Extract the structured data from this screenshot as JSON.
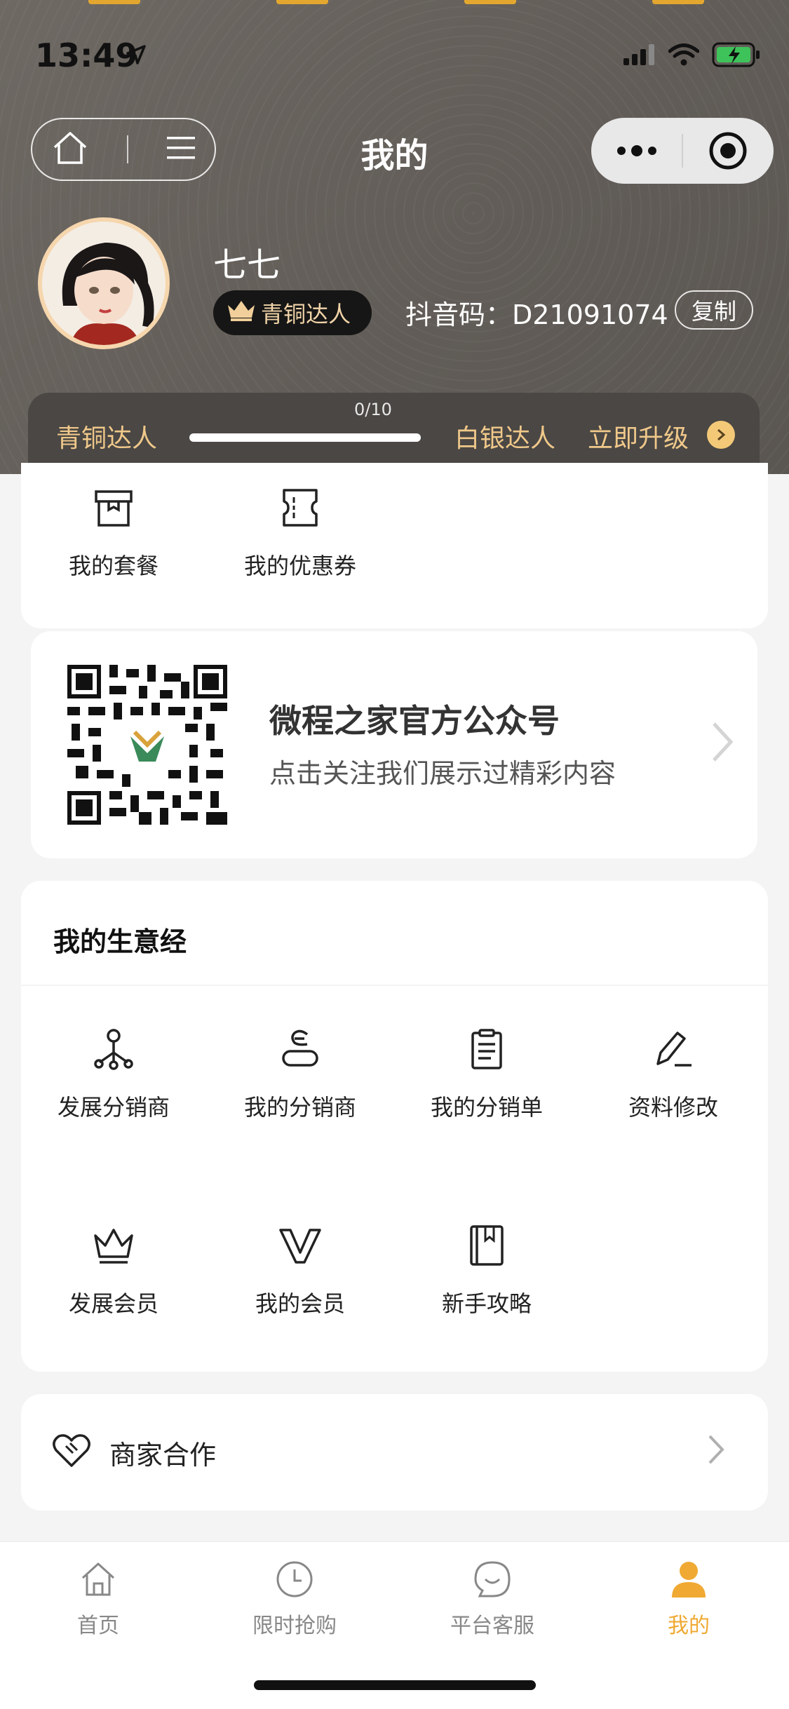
{
  "status_bar": {
    "time": "13:49"
  },
  "nav": {
    "title": "我的"
  },
  "profile": {
    "name": "七七",
    "level": "青铜达人",
    "douyin_code": "抖音码：D21091074",
    "copy_label": "复制"
  },
  "progress": {
    "current_level": "青铜达人",
    "count": "0/10",
    "fraction": 0,
    "next_level": "白银达人",
    "upgrade_label": "立即升级"
  },
  "quick_links": [
    {
      "label": "我的套餐",
      "icon": "package-icon"
    },
    {
      "label": "我的优惠券",
      "icon": "coupon-icon"
    }
  ],
  "official_account": {
    "title": "微程之家官方公众号",
    "subtitle": "点击关注我们展示过精彩内容"
  },
  "business": {
    "title": "我的生意经",
    "items": [
      {
        "label": "发展分销商",
        "icon": "network-icon"
      },
      {
        "label": "我的分销商",
        "icon": "distributor-icon"
      },
      {
        "label": "我的分销单",
        "icon": "clipboard-icon"
      },
      {
        "label": "资料修改",
        "icon": "edit-icon"
      },
      {
        "label": "发展会员",
        "icon": "crown-icon"
      },
      {
        "label": "我的会员",
        "icon": "v-icon"
      },
      {
        "label": "新手攻略",
        "icon": "book-icon"
      }
    ]
  },
  "cooperation": {
    "label": "商家合作"
  },
  "tabbar": {
    "items": [
      {
        "label": "首页",
        "icon": "home-icon"
      },
      {
        "label": "限时抢购",
        "icon": "clock-icon"
      },
      {
        "label": "平台客服",
        "icon": "chat-icon"
      },
      {
        "label": "我的",
        "icon": "person-icon"
      }
    ],
    "active_index": 3
  },
  "colors": {
    "accent": "#f0a933",
    "header_bg": "#67625d",
    "gold_text": "#f0c88a"
  }
}
